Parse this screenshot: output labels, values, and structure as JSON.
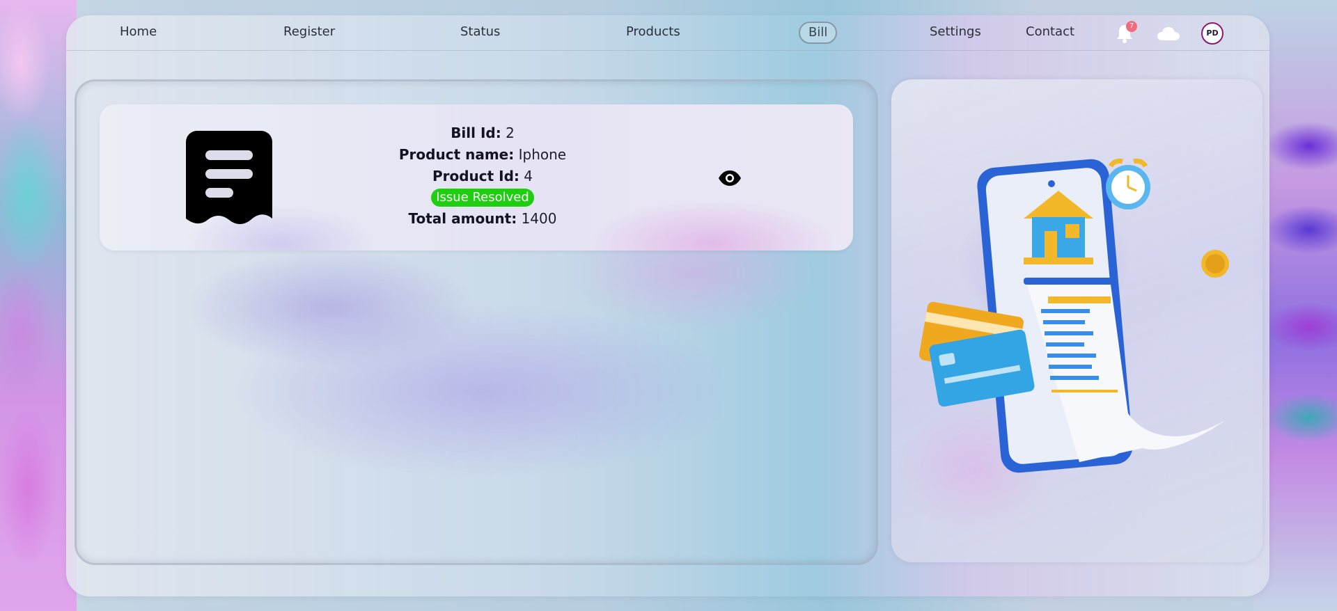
{
  "nav": {
    "items": [
      {
        "label": "Home",
        "name": "nav-home"
      },
      {
        "label": "Register",
        "name": "nav-register"
      },
      {
        "label": "Status",
        "name": "nav-status"
      },
      {
        "label": "Products",
        "name": "nav-products"
      },
      {
        "label": "Bill",
        "name": "nav-bill",
        "active": true
      },
      {
        "label": "Settings",
        "name": "nav-settings"
      },
      {
        "label": "Contact",
        "name": "nav-contact"
      }
    ],
    "notification_count": "7",
    "avatar_initials": "PD",
    "icons": [
      "bell-icon",
      "cloud-icon"
    ]
  },
  "bill": {
    "bill_id_label": "Bill Id:",
    "bill_id": "2",
    "product_name_label": "Product name:",
    "product_name": "Iphone",
    "product_id_label": "Product Id:",
    "product_id": "4",
    "status": "Issue Resolved",
    "total_label": "Total amount:",
    "total": "1400",
    "icons": [
      "receipt-icon",
      "eye-icon"
    ]
  },
  "colors": {
    "status_green": "#1ecf10",
    "badge_red": "#f26b7d",
    "avatar_border": "#8a1a6b"
  }
}
